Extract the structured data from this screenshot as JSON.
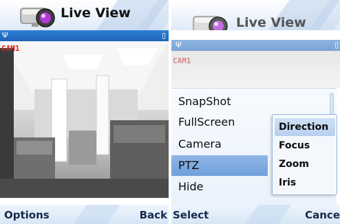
{
  "left_screen": {
    "title": "Live View",
    "camera_label": "CAM1",
    "softkeys": {
      "left": "Options",
      "right": "Back"
    }
  },
  "right_screen": {
    "title": "Live View",
    "camera_label": "CAM1",
    "menu": {
      "items": [
        {
          "label": "SnapShot"
        },
        {
          "label": "FullScreen"
        },
        {
          "label": "Camera"
        },
        {
          "label": "PTZ",
          "selected": true
        },
        {
          "label": "Hide"
        }
      ]
    },
    "submenu": {
      "items": [
        {
          "label": "Direction",
          "selected": true
        },
        {
          "label": "Focus"
        },
        {
          "label": "Zoom"
        },
        {
          "label": "Iris"
        }
      ]
    },
    "softkeys": {
      "left": "Select",
      "right": "Cance"
    }
  },
  "colors": {
    "status_strip": "#1d63b8",
    "cam_label": "#e0241c",
    "menu_highlight": "#6f9fdb"
  },
  "icons": [
    "camera-app-icon",
    "signal-icon",
    "battery-icon",
    "scroll-indicator"
  ]
}
